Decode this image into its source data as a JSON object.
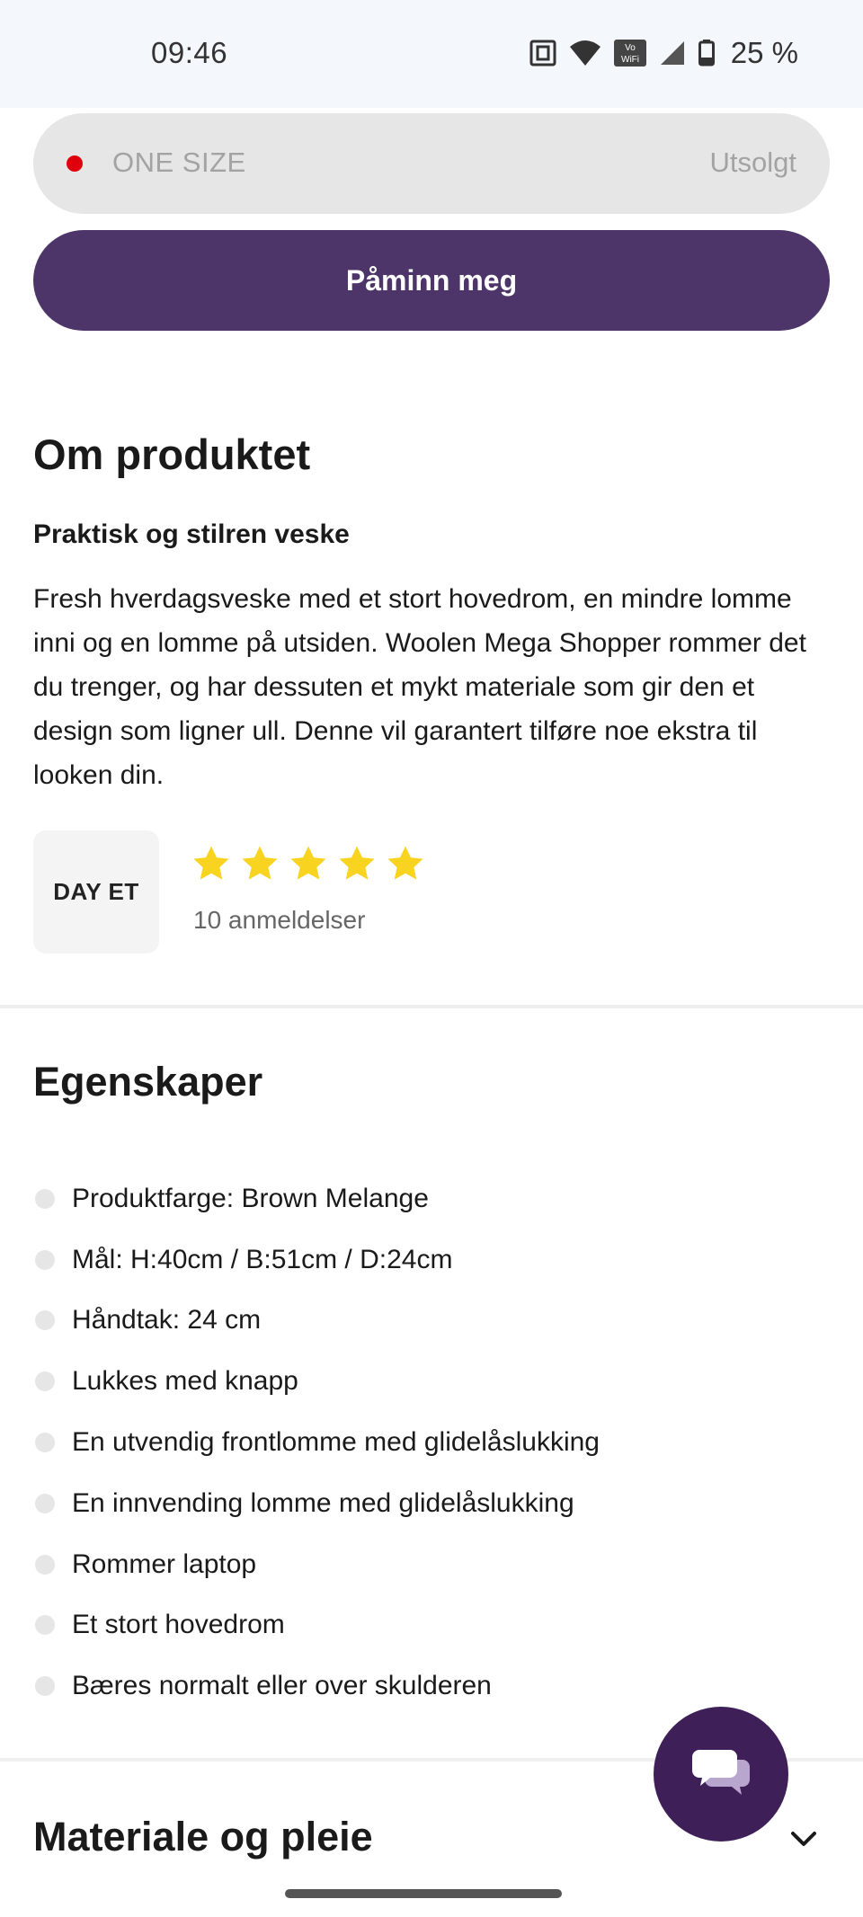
{
  "status_bar": {
    "time": "09:46",
    "battery": "25 %"
  },
  "size_selector": {
    "label": "ONE SIZE",
    "status": "Utsolgt"
  },
  "remind_button": {
    "label": "Påminn meg"
  },
  "about": {
    "title": "Om produktet",
    "subtitle": "Praktisk og stilren veske",
    "description": "Fresh hverdagsveske med et stort hovedrom, en mindre lomme inni og en lomme på utsiden. Woolen Mega Shopper rommer det du trenger, og har dessuten et mykt materiale som gir den et design som ligner ull. Denne vil garantert tilføre noe ekstra til looken din."
  },
  "rating": {
    "brand": "DAY ET",
    "stars": 5,
    "star_color": "#f8d31f",
    "reviews": "10 anmeldelser"
  },
  "features": {
    "title": "Egenskaper",
    "items": [
      "Produktfarge: Brown Melange",
      "Mål: H:40cm / B:51cm / D:24cm",
      "Håndtak: 24 cm",
      "Lukkes med knapp",
      "En utvendig frontlomme med glidelåslukking",
      "En innvending lomme med glidelåslukking",
      "Rommer laptop",
      "Et stort hovedrom",
      "Bæres normalt eller over skulderen"
    ]
  },
  "material": {
    "title": "Materiale og pleie"
  },
  "colors": {
    "primary_button": "#4d3569",
    "chat_button": "#3e1f57",
    "sold_out_dot": "#e0000d"
  },
  "icons": {
    "chat": "chat-bubbles-icon",
    "expand": "chevron-down-icon"
  }
}
